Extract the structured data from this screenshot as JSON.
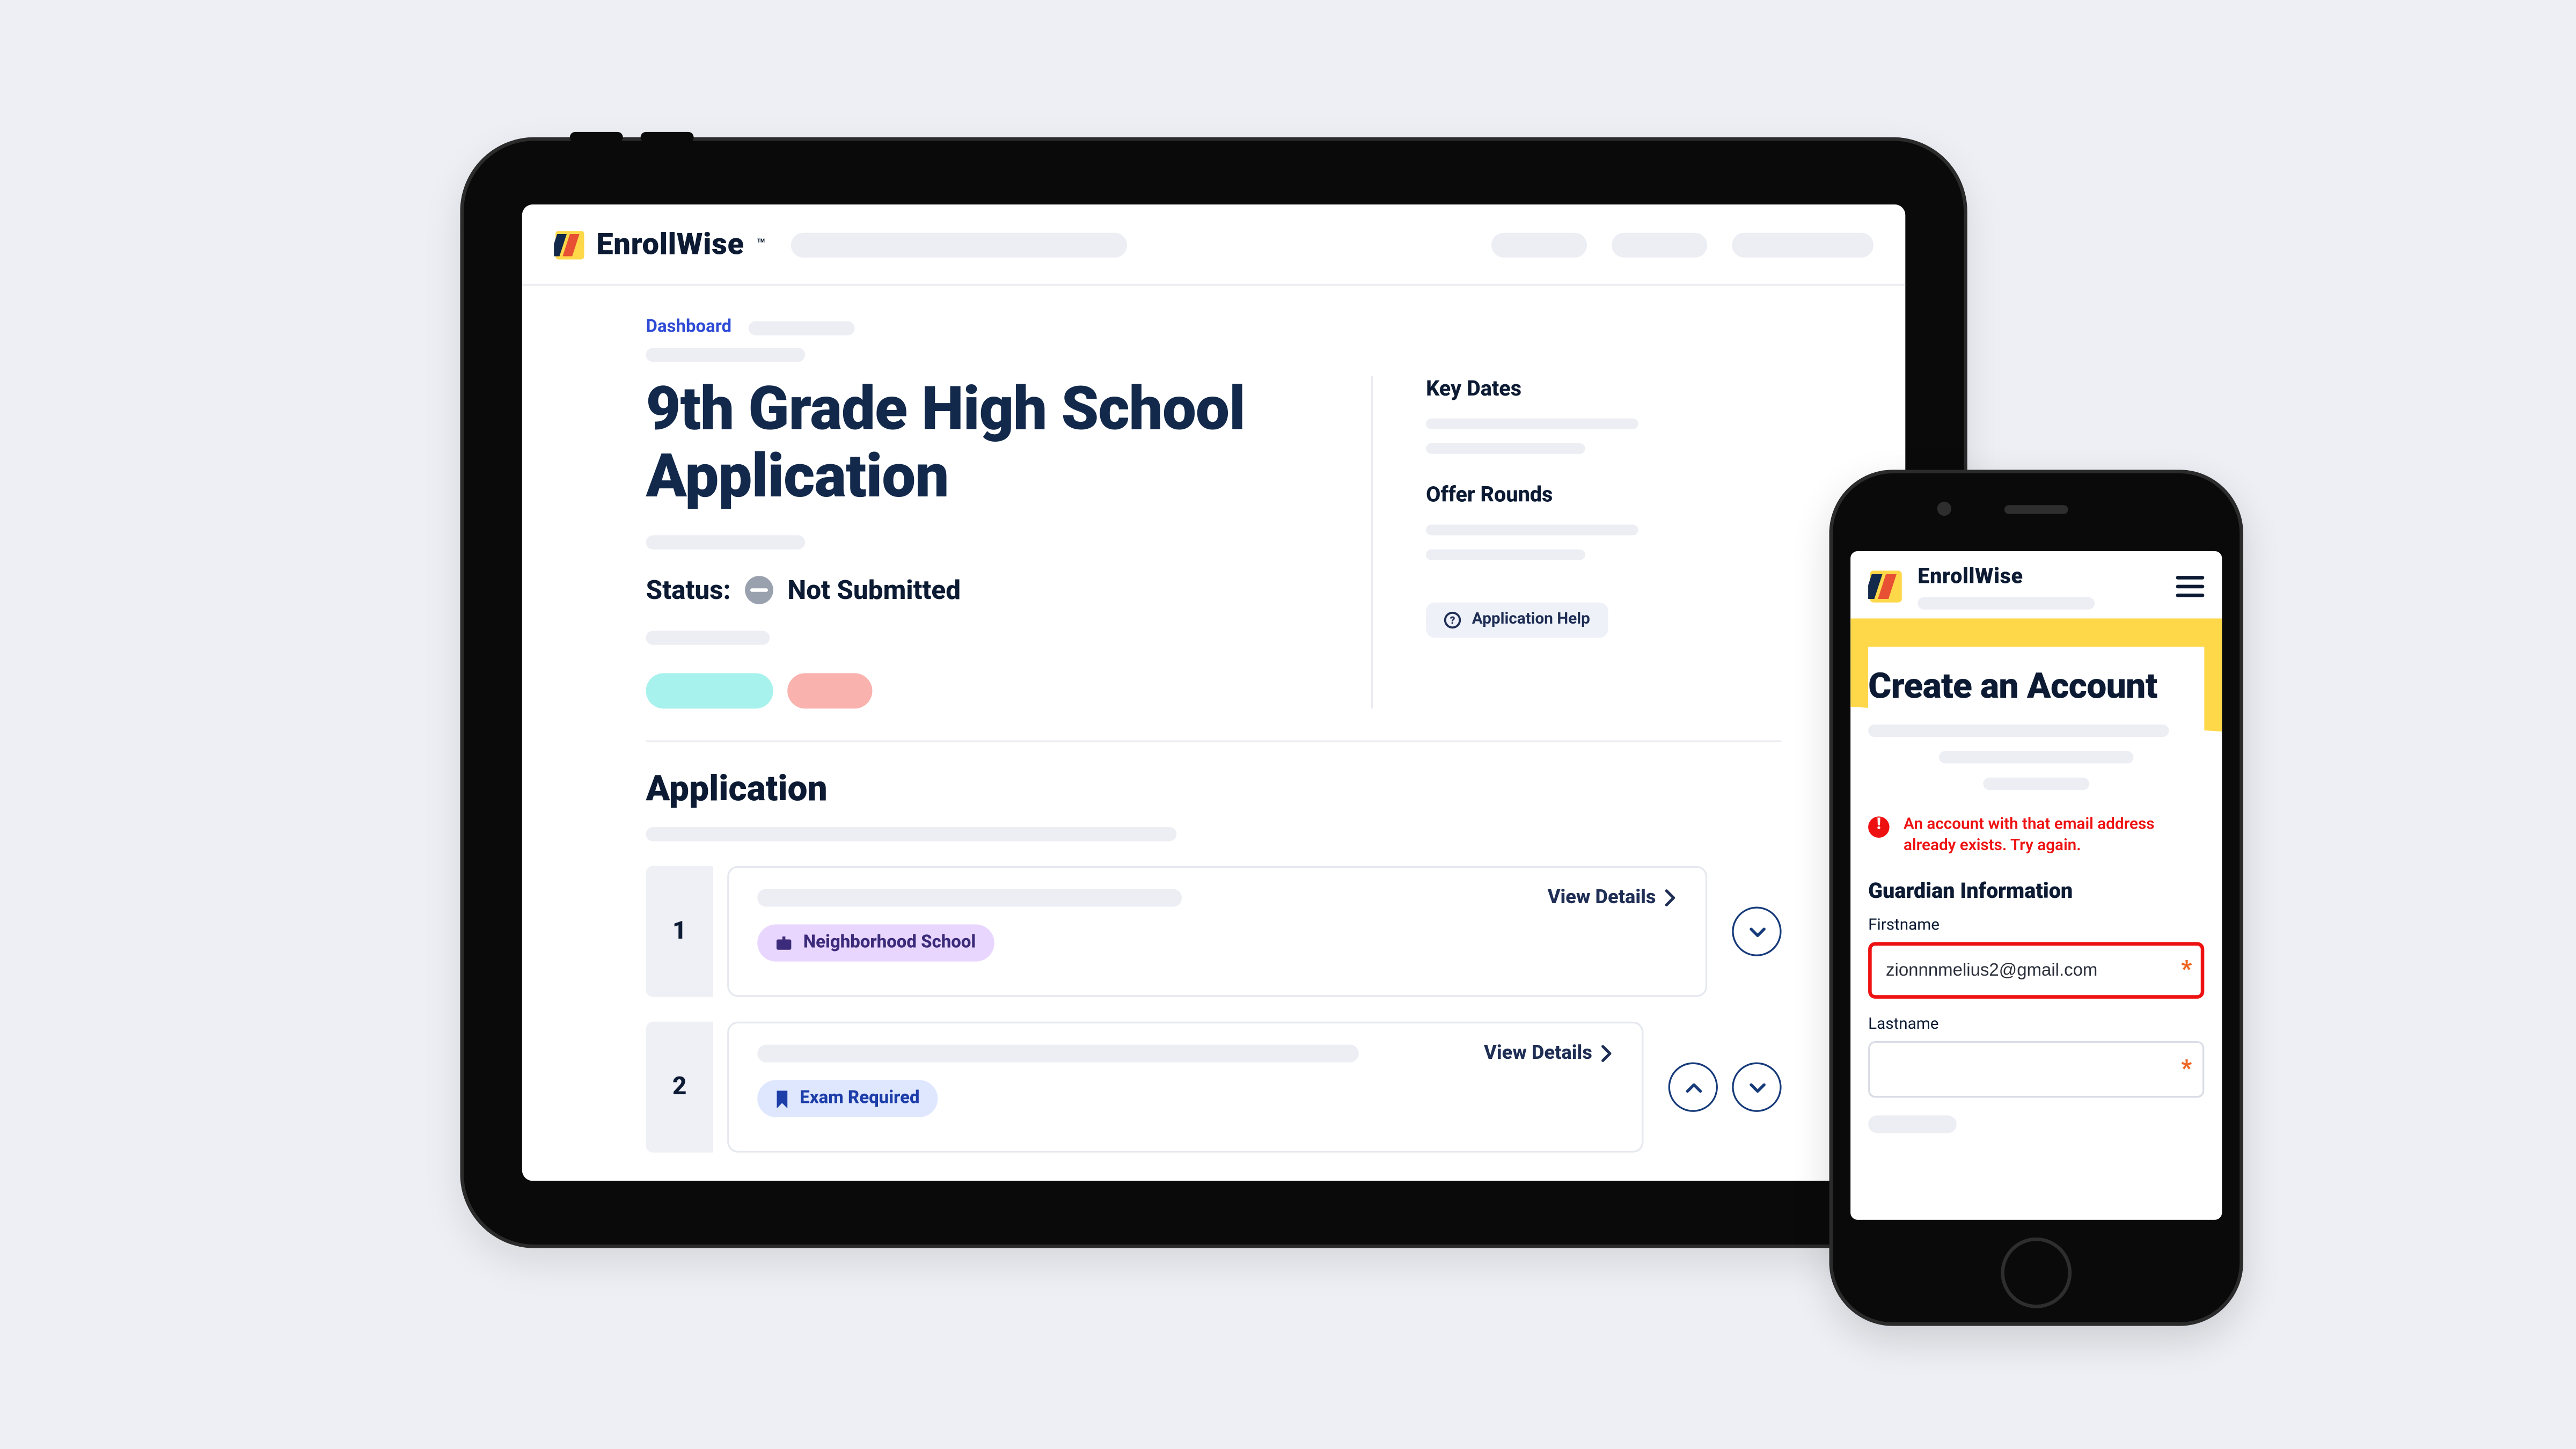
{
  "brand": {
    "name": "EnrollWise",
    "tm": "™"
  },
  "tablet": {
    "breadcrumb": "Dashboard",
    "title": "9th Grade High School Application",
    "status_label": "Status:",
    "status_value": "Not Submitted",
    "sidebar": {
      "key_dates": "Key Dates",
      "offer_rounds": "Offer Rounds",
      "help_label": "Application Help"
    },
    "section_title": "Application",
    "rows": [
      {
        "num": "1",
        "badge": "Neighborhood School",
        "view": "View Details",
        "reorder": [
          "down"
        ]
      },
      {
        "num": "2",
        "badge": "Exam Required",
        "view": "View Details",
        "reorder": [
          "up",
          "down"
        ]
      }
    ]
  },
  "phone": {
    "title": "Create an Account",
    "error": "An account with that email address already exists. Try again.",
    "section": "Guardian Information",
    "fields": {
      "first_label": "Firstname",
      "first_value": "zionnnmelius2@gmail.com",
      "last_label": "Lastname",
      "last_value": ""
    }
  }
}
